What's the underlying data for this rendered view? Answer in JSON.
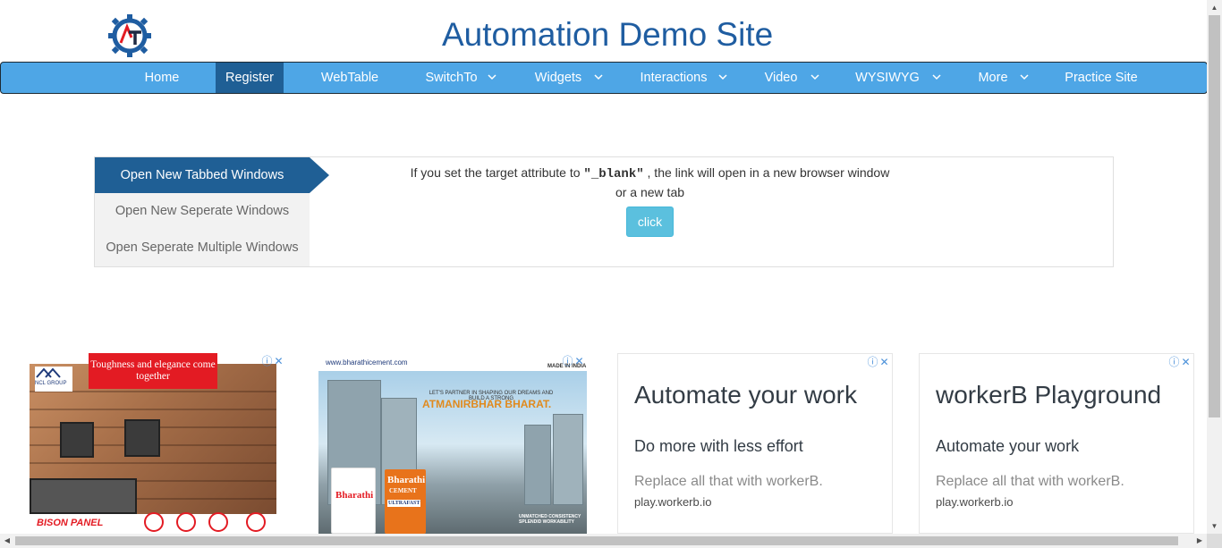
{
  "header": {
    "title": "Automation Demo Site",
    "logo_text": "AT",
    "logo_icon": "gear-logo-icon"
  },
  "nav": {
    "items": [
      {
        "label": "Home",
        "dropdown": false,
        "active": false
      },
      {
        "label": "Register",
        "dropdown": false,
        "active": true
      },
      {
        "label": "WebTable",
        "dropdown": false,
        "active": false
      },
      {
        "label": "SwitchTo",
        "dropdown": true,
        "active": false
      },
      {
        "label": "Widgets",
        "dropdown": true,
        "active": false
      },
      {
        "label": "Interactions",
        "dropdown": true,
        "active": false
      },
      {
        "label": "Video",
        "dropdown": true,
        "active": false
      },
      {
        "label": "WYSIWYG",
        "dropdown": true,
        "active": false
      },
      {
        "label": "More",
        "dropdown": true,
        "active": false
      },
      {
        "label": "Practice Site",
        "dropdown": false,
        "active": false
      }
    ],
    "bar_color": "#4ea6e6",
    "active_color": "#1f5f95"
  },
  "windows": {
    "tabs": [
      {
        "label": "Open New Tabbed Windows",
        "active": true
      },
      {
        "label": "Open New Seperate Windows",
        "active": false
      },
      {
        "label": "Open Seperate Multiple Windows",
        "active": false
      }
    ],
    "description_prefix": "If you set the target attribute to",
    "description_code": "\"_blank\"",
    "description_suffix": ", the link will open in a new browser window",
    "description_line2": "or a new tab",
    "button_label": "click",
    "button_color": "#5bc0de"
  },
  "ads": {
    "ad1": {
      "headline": "Toughness and elegance come together",
      "brand_small": "NCL GROUP",
      "bottom_brand": "BISON PANEL"
    },
    "ad2": {
      "url": "www.bharathicement.com",
      "slogan": "LET'S PARTNER IN SHAPING OUR DREAMS AND BUILD A STRONG",
      "headline": "ATMANIRBHAR BHARAT.",
      "badge": "MADE IN INDIA",
      "bag_brand": "Bharathi",
      "bag_sub": "CEMENT",
      "bag_variant": "ULTRAFAST",
      "tagline": "UNMATCHED CONSISTENCY SPLENDID WORKABILITY"
    },
    "ad3": {
      "headline": "Automate your work",
      "sub": "Do more with less effort",
      "body": "Replace all that with workerB.",
      "url": "play.workerb.io"
    },
    "ad4": {
      "headline": "workerB Playground",
      "sub": "Automate your work",
      "body": "Replace all that with workerB.",
      "url": "play.workerb.io"
    },
    "info_icon": "ⓘ",
    "close_icon": "✕"
  }
}
